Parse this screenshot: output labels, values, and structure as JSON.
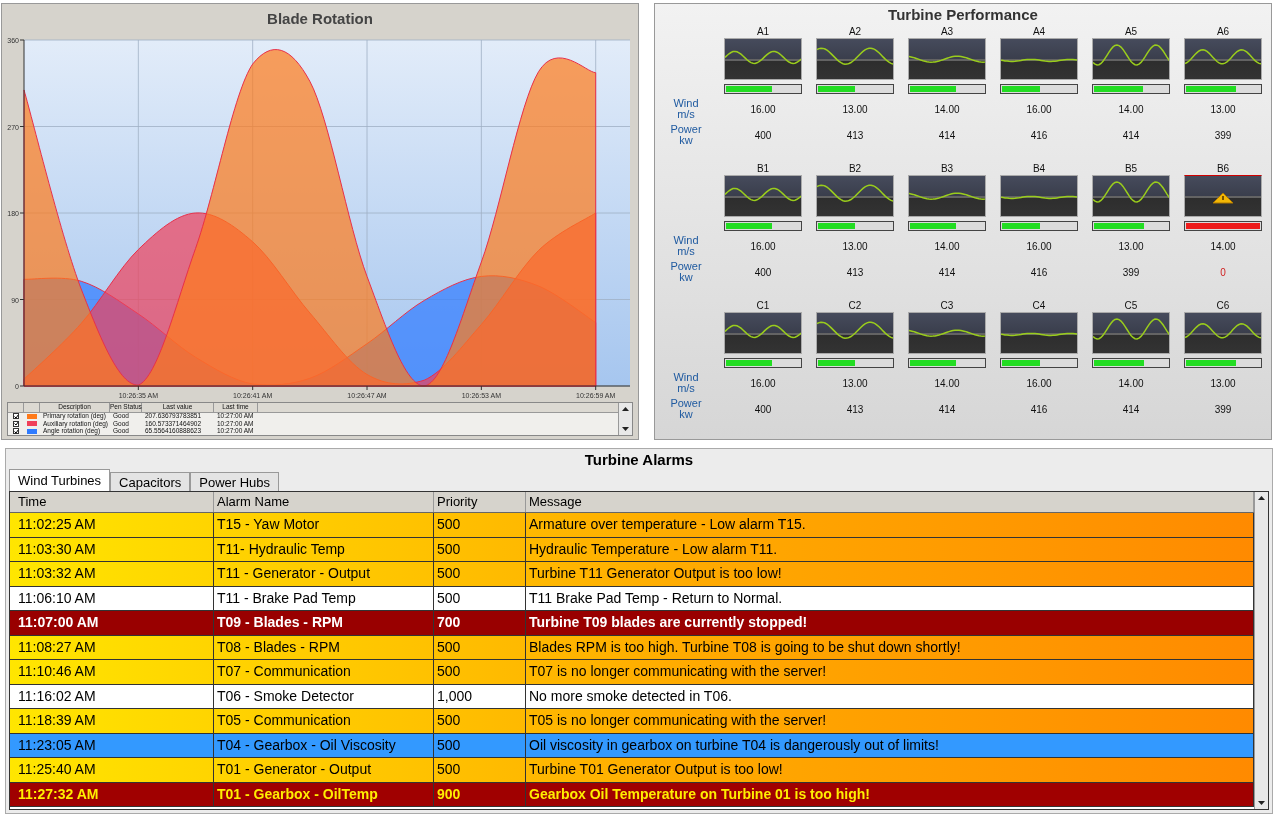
{
  "blade_rotation": {
    "title": "Blade Rotation",
    "chart_data": {
      "type": "area",
      "categories": [
        null,
        null,
        "10:26:35 AM",
        null,
        "10:26:41 AM",
        null,
        "10:26:47 AM",
        null,
        "10:26:53 AM",
        null,
        "10:26:59 AM"
      ],
      "ylim": [
        0,
        360
      ],
      "yticks": [
        0,
        90,
        180,
        270,
        360
      ],
      "grid": true,
      "stacked": false,
      "series": [
        {
          "name": "Primary rotation (deg)",
          "color": "#ff7a1a",
          "values": [
            308,
            101,
            1,
            143,
            335,
            317,
            114,
            0,
            129,
            327,
            326
          ]
        },
        {
          "name": "Auxiliary rotation (deg)",
          "color": "#f0405a",
          "values": [
            7,
            65,
            142,
            180,
            150,
            76,
            12,
            6,
            64,
            141,
            180
          ]
        },
        {
          "name": "Angle rotation (deg)",
          "color": "#2f7bff",
          "values": [
            111,
            109,
            75,
            30,
            2,
            8,
            44,
            89,
            114,
            104,
            66
          ]
        }
      ]
    },
    "legend": {
      "columns": [
        "Description",
        "Pen Status",
        "Last value",
        "Last time"
      ],
      "rows": [
        {
          "checked": true,
          "status": "Good",
          "last_value": "207.636793783851",
          "last_time": "10:27:00 AM"
        },
        {
          "checked": true,
          "status": "Good",
          "last_value": "160.573371464902",
          "last_time": "10:27:00 AM"
        },
        {
          "checked": true,
          "status": "Good",
          "last_value": "65.5564160888623",
          "last_time": "10:27:00 AM"
        }
      ]
    }
  },
  "turbine_performance": {
    "title": "Turbine Performance",
    "groups": [
      {
        "wind_label": "Wind m/s",
        "power_label": "Power kw",
        "turbines": [
          {
            "name": "A1",
            "alarm": false,
            "level": 0.62,
            "wind": "16.00",
            "power": "400"
          },
          {
            "name": "A2",
            "alarm": false,
            "level": 0.5,
            "wind": "13.00",
            "power": "413"
          },
          {
            "name": "A3",
            "alarm": false,
            "level": 0.62,
            "wind": "14.00",
            "power": "414"
          },
          {
            "name": "A4",
            "alarm": false,
            "level": 0.52,
            "wind": "16.00",
            "power": "416"
          },
          {
            "name": "A5",
            "alarm": false,
            "level": 0.66,
            "wind": "14.00",
            "power": "414"
          },
          {
            "name": "A6",
            "alarm": false,
            "level": 0.67,
            "wind": "13.00",
            "power": "399"
          }
        ]
      },
      {
        "wind_label": "Wind m/s",
        "power_label": "Power kw",
        "turbines": [
          {
            "name": "B1",
            "alarm": false,
            "level": 0.62,
            "wind": "16.00",
            "power": "400"
          },
          {
            "name": "B2",
            "alarm": false,
            "level": 0.5,
            "wind": "13.00",
            "power": "413"
          },
          {
            "name": "B3",
            "alarm": false,
            "level": 0.62,
            "wind": "14.00",
            "power": "414"
          },
          {
            "name": "B4",
            "alarm": false,
            "level": 0.52,
            "wind": "16.00",
            "power": "416"
          },
          {
            "name": "B5",
            "alarm": false,
            "level": 0.67,
            "wind": "13.00",
            "power": "399"
          },
          {
            "name": "B6",
            "alarm": true,
            "level": 1,
            "wind": "14.00",
            "power": "0"
          }
        ]
      },
      {
        "wind_label": "Wind m/s",
        "power_label": "Power kw",
        "turbines": [
          {
            "name": "C1",
            "alarm": false,
            "level": 0.62,
            "wind": "16.00",
            "power": "400"
          },
          {
            "name": "C2",
            "alarm": false,
            "level": 0.5,
            "wind": "13.00",
            "power": "413"
          },
          {
            "name": "C3",
            "alarm": false,
            "level": 0.62,
            "wind": "14.00",
            "power": "414"
          },
          {
            "name": "C4",
            "alarm": false,
            "level": 0.52,
            "wind": "16.00",
            "power": "416"
          },
          {
            "name": "C5",
            "alarm": false,
            "level": 0.67,
            "wind": "14.00",
            "power": "414"
          },
          {
            "name": "C6",
            "alarm": false,
            "level": 0.67,
            "wind": "13.00",
            "power": "399"
          }
        ]
      }
    ]
  },
  "turbine_alarms": {
    "title": "Turbine Alarms",
    "tabs": [
      {
        "label": "Wind Turbines",
        "selected": true
      },
      {
        "label": "Capacitors",
        "selected": false
      },
      {
        "label": "Power Hubs",
        "selected": false
      }
    ],
    "columns": [
      "Time",
      "Alarm Name",
      "Priority",
      "Message"
    ],
    "rows": [
      {
        "kind": "warning",
        "time": "11:02:25 AM",
        "name": "T15 - Yaw Motor",
        "priority": "500",
        "message": "Armature over temperature - Low alarm T15."
      },
      {
        "kind": "warning",
        "time": "11:03:30 AM",
        "name": "T11- Hydraulic Temp",
        "priority": "500",
        "message": "Hydraulic Temperature - Low alarm T11."
      },
      {
        "kind": "warning",
        "time": "11:03:32 AM",
        "name": "T11 - Generator - Output",
        "priority": "500",
        "message": "Turbine T11 Generator Output is too low!"
      },
      {
        "kind": "normal",
        "time": "11:06:10 AM",
        "name": "T11 - Brake Pad Temp",
        "priority": "500",
        "message": "T11 Brake Pad Temp - Return to Normal."
      },
      {
        "kind": "critical",
        "time": "11:07:00 AM",
        "name": "T09 - Blades - RPM",
        "priority": "700",
        "message": "Turbine T09 blades are currently stopped!"
      },
      {
        "kind": "warning",
        "time": "11:08:27 AM",
        "name": "T08 - Blades - RPM",
        "priority": "500",
        "message": "Blades RPM is too high. Turbine T08 is going to be shut down shortly!"
      },
      {
        "kind": "warning",
        "time": "11:10:46 AM",
        "name": "T07 - Communication",
        "priority": "500",
        "message": "T07 is no longer communicating with the server!"
      },
      {
        "kind": "normal",
        "time": "11:16:02 AM",
        "name": "T06 - Smoke Detector",
        "priority": "1,000",
        "message": "No more smoke detected in T06."
      },
      {
        "kind": "warning",
        "time": "11:18:39 AM",
        "name": "T05 - Communication",
        "priority": "500",
        "message": "T05 is no longer communicating with the server!"
      },
      {
        "kind": "info",
        "time": "11:23:05 AM",
        "name": "T04 - Gearbox - Oil Viscosity",
        "priority": "500",
        "message": "Oil viscosity in gearbox on turbine T04 is dangerously out of limits!"
      },
      {
        "kind": "warning",
        "time": "11:25:40 AM",
        "name": "T01 - Generator - Output",
        "priority": "500",
        "message": "Turbine T01 Generator Output is too low!"
      },
      {
        "kind": "emergency",
        "time": "11:27:32 AM",
        "name": "T01 - Gearbox - OilTemp",
        "priority": "900",
        "message": "Gearbox Oil Temperature on Turbine 01 is too high!"
      }
    ]
  }
}
